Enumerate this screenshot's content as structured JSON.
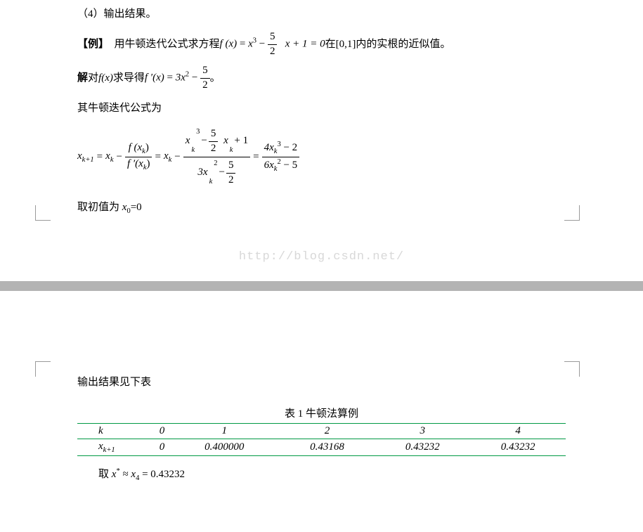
{
  "topline": "（4）输出结果。",
  "example_label": "【例】",
  "example_text_a": "用牛顿迭代公式求方程 ",
  "example_text_b": " 在[0,1]内的实根的近似值。",
  "eq1_lhs": "f (x)",
  "eq1_rhs_a": "x",
  "eq1_rhs_a_sup": "3",
  "eq1_frac52_num": "5",
  "eq1_frac52_den": "2",
  "eq1_rhs_b": "x + 1 = 0",
  "solve_label": "解",
  "solve_text_a": " 对",
  "solve_fx": " f(x)",
  "solve_text_b": "求导得 ",
  "eq2_lhs": "f ′(x)",
  "eq2_rhs_a": "3x",
  "eq2_rhs_a_sup": "2",
  "newton_intro": "其牛顿迭代公式为",
  "big_lhs_a": "x",
  "big_lhs_a_sub": "k+1",
  "big_eq": " = ",
  "big_mid_a": "x",
  "big_mid_a_sub": "k",
  "big_minus": " − ",
  "big_frac1_num": "f (x",
  "big_frac1_num_sub": "k",
  "big_frac1_num_close": ")",
  "big_frac1_den": "f ′(x",
  "big_frac1_den_sub": "k",
  "big_frac1_den_close": ")",
  "big_frac2_num_a": "x",
  "big_frac2_num_a_sub": "k",
  "big_frac2_num_a_sup": "3",
  "big_frac2_num_b": "x",
  "big_frac2_num_b_sub": "k",
  "big_frac2_num_c": " + 1",
  "big_frac2_den_a": "3x",
  "big_frac2_den_a_sub": "k",
  "big_frac2_den_a_sup": "2",
  "big_frac3_num": "4x",
  "big_frac3_num_sub": "k",
  "big_frac3_num_sup": "3",
  "big_frac3_num_b": " − 2",
  "big_frac3_den": "6x",
  "big_frac3_den_sub": "k",
  "big_frac3_den_sup": "2",
  "big_frac3_den_b": " − 5",
  "init_text_a": "取初值为 ",
  "init_var": "x",
  "init_sub": "0",
  "init_eq": "=0",
  "watermark": "http://blog.csdn.net/",
  "output_intro": "输出结果见下表",
  "table_caption": "表 1 牛顿法算例",
  "table": {
    "row1": [
      "k",
      "0",
      "1",
      "2",
      "3",
      "4"
    ],
    "row2": [
      "xk+1",
      "0",
      "0.400000",
      "0.43168",
      "0.43232",
      "0.43232"
    ]
  },
  "final_a": "取 ",
  "final_xstar": "x",
  "final_star": "*",
  "final_approx": " ≈ ",
  "final_x4": "x",
  "final_4": "4",
  "final_val": " = 0.43232",
  "period": " 。"
}
